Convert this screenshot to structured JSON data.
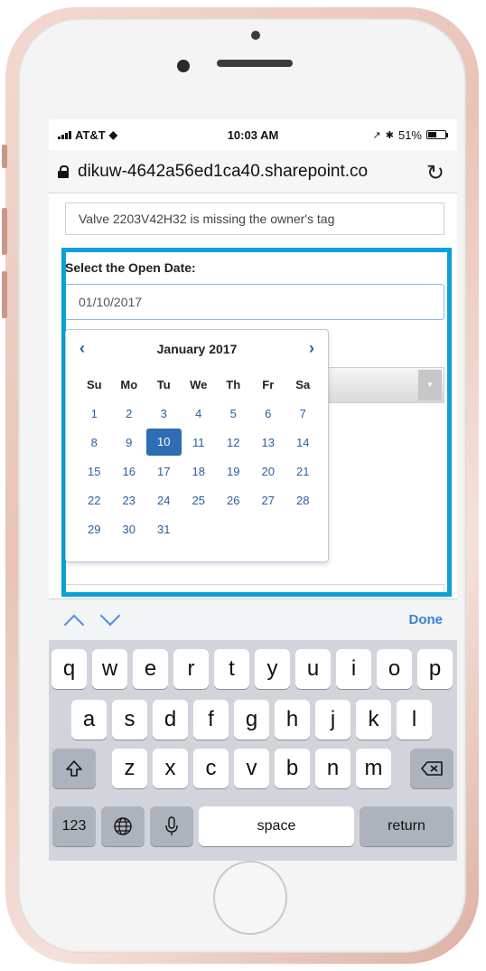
{
  "status_bar": {
    "carrier": "AT&T",
    "time": "10:03 AM",
    "battery": "51%",
    "battery_level": 0.51
  },
  "browser": {
    "url": "dikuw-4642a56ed1ca40.sharepoint.co",
    "reload_icon": "reload-icon",
    "lock_icon": "lock-icon"
  },
  "form": {
    "description_value": "Valve 2203V42H32 is missing the owner's tag",
    "open_date_label": "Select the Open Date:",
    "open_date_value": "01/10/2017",
    "highlight_color": "#0aa1d8"
  },
  "calendar": {
    "title": "January 2017",
    "prev_label": "‹",
    "next_label": "›",
    "weekdays": [
      "Su",
      "Mo",
      "Tu",
      "We",
      "Th",
      "Fr",
      "Sa"
    ],
    "weeks": [
      [
        "1",
        "2",
        "3",
        "4",
        "5",
        "6",
        "7"
      ],
      [
        "8",
        "9",
        "10",
        "11",
        "12",
        "13",
        "14"
      ],
      [
        "15",
        "16",
        "17",
        "18",
        "19",
        "20",
        "21"
      ],
      [
        "22",
        "23",
        "24",
        "25",
        "26",
        "27",
        "28"
      ],
      [
        "29",
        "30",
        "31",
        "",
        "",
        "",
        ""
      ]
    ],
    "selected_day": "10",
    "selected_color": "#2f6db5"
  },
  "keyboard": {
    "done_label": "Done",
    "row1": [
      "q",
      "w",
      "e",
      "r",
      "t",
      "y",
      "u",
      "i",
      "o",
      "p"
    ],
    "row2": [
      "a",
      "s",
      "d",
      "f",
      "g",
      "h",
      "j",
      "k",
      "l"
    ],
    "row3": [
      "z",
      "x",
      "c",
      "v",
      "b",
      "n",
      "m"
    ],
    "numbers_label": "123",
    "space_label": "space",
    "return_label": "return",
    "shift_icon": "shift-icon",
    "backspace_icon": "backspace-icon",
    "globe_icon": "globe-icon",
    "mic_icon": "microphone-icon"
  }
}
